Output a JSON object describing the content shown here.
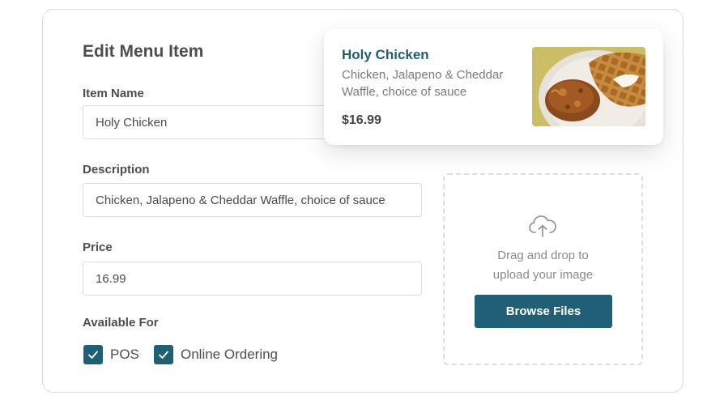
{
  "form": {
    "title": "Edit Menu Item",
    "item_name_label": "Item Name",
    "item_name_value": "Holy Chicken",
    "description_label": "Description",
    "description_value": "Chicken, Jalapeno & Cheddar Waffle, choice of sauce",
    "price_label": "Price",
    "price_value": "16.99",
    "available_label": "Available For",
    "options": [
      {
        "label": "POS",
        "checked": true
      },
      {
        "label": "Online Ordering",
        "checked": true
      }
    ]
  },
  "upload": {
    "icon": "cloud-upload-icon",
    "text_line1": "Drag and drop to",
    "text_line2": "upload your image",
    "button_label": "Browse Files"
  },
  "preview": {
    "name": "Holy Chicken",
    "description": "Chicken, Jalapeno & Cheddar Waffle, choice of sauce",
    "price": "$16.99"
  },
  "colors": {
    "accent": "#215f77",
    "preview_title": "#1f5d74"
  }
}
